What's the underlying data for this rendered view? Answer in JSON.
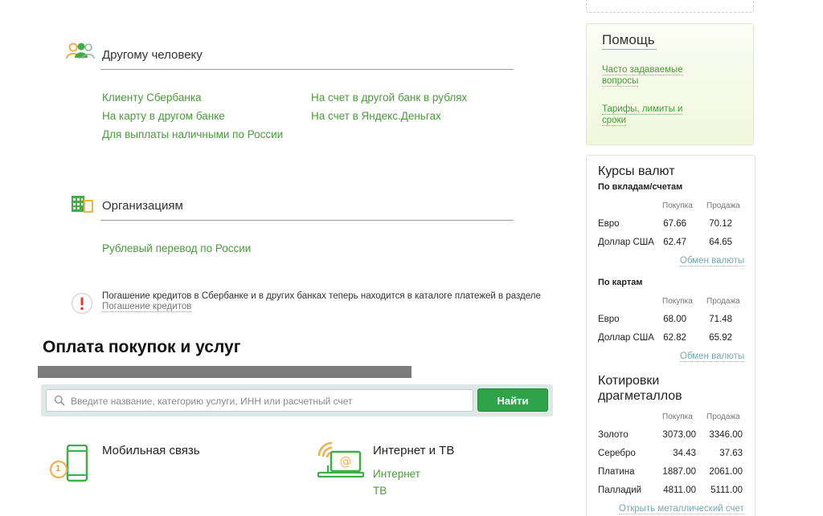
{
  "transfers": {
    "person": {
      "title": "Другому человеку",
      "links": [
        "Клиенту Сбербанка",
        "На карту в другом банке",
        "Для выплаты наличными по России",
        "На счет в другой банк в рублях",
        "На счет в Яндекс.Деньгах"
      ]
    },
    "org": {
      "title": "Организациям",
      "links": [
        "Рублевый перевод по России"
      ]
    },
    "notice": {
      "text": "Погашение кредитов в Сбербанке и в других банках теперь находится в каталоге платежей в разделе",
      "link": "Погашение кредитов"
    }
  },
  "payments": {
    "title": "Оплата покупок и услуг",
    "search": {
      "placeholder": "Введите название, категорию услуги, ИНН или расчетный счет",
      "button": "Найти"
    },
    "categories": [
      {
        "title": "Мобильная связь",
        "badge": "1",
        "links": []
      },
      {
        "title": "Интернет и ТВ",
        "links": [
          "Интернет",
          "ТВ"
        ]
      }
    ]
  },
  "sidebar": {
    "help": {
      "title": "Помощь",
      "links": [
        "Часто задаваемые вопросы",
        "Тарифы, лимиты и сроки"
      ]
    },
    "rates": {
      "title": "Курсы валют",
      "buy_label": "Покупка",
      "sell_label": "Продажа",
      "deposits": {
        "title": "По вкладам/счетам",
        "rows": [
          {
            "name": "Евро",
            "buy": "67.66",
            "sell": "70.12"
          },
          {
            "name": "Доллар США",
            "buy": "62.47",
            "sell": "64.65"
          }
        ],
        "link": "Обмен валюты"
      },
      "cards": {
        "title": "По картам",
        "rows": [
          {
            "name": "Евро",
            "buy": "68.00",
            "sell": "71.48"
          },
          {
            "name": "Доллар США",
            "buy": "62.82",
            "sell": "65.92"
          }
        ],
        "link": "Обмен валюты"
      }
    },
    "metals": {
      "title_line1": "Котировки",
      "title_line2": "драгметаллов",
      "buy_label": "Покупка",
      "sell_label": "Продажа",
      "rows": [
        {
          "name": "Золото",
          "buy": "3073.00",
          "sell": "3346.00"
        },
        {
          "name": "Серебро",
          "buy": "34.43",
          "sell": "37.63"
        },
        {
          "name": "Платина",
          "buy": "1887.00",
          "sell": "2061.00"
        },
        {
          "name": "Палладий",
          "buy": "4811.00",
          "sell": "5111.00"
        }
      ],
      "link": "Открыть металлический счет"
    }
  },
  "colors": {
    "accent": "#2fa34a",
    "link": "#4a9a3b"
  }
}
